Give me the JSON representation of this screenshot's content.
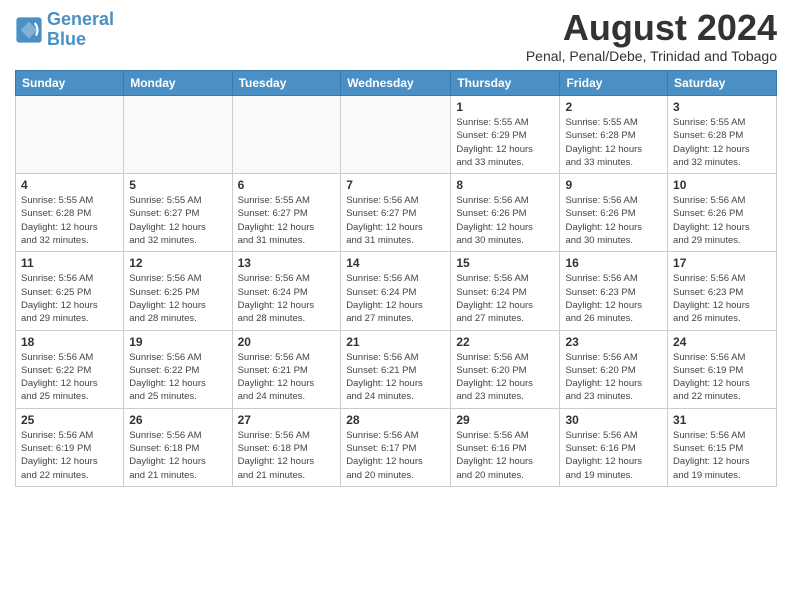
{
  "logo": {
    "text1": "General",
    "text2": "Blue"
  },
  "title": "August 2024",
  "location": "Penal, Penal/Debe, Trinidad and Tobago",
  "days_of_week": [
    "Sunday",
    "Monday",
    "Tuesday",
    "Wednesday",
    "Thursday",
    "Friday",
    "Saturday"
  ],
  "weeks": [
    [
      {
        "day": "",
        "info": ""
      },
      {
        "day": "",
        "info": ""
      },
      {
        "day": "",
        "info": ""
      },
      {
        "day": "",
        "info": ""
      },
      {
        "day": "1",
        "info": "Sunrise: 5:55 AM\nSunset: 6:29 PM\nDaylight: 12 hours\nand 33 minutes."
      },
      {
        "day": "2",
        "info": "Sunrise: 5:55 AM\nSunset: 6:28 PM\nDaylight: 12 hours\nand 33 minutes."
      },
      {
        "day": "3",
        "info": "Sunrise: 5:55 AM\nSunset: 6:28 PM\nDaylight: 12 hours\nand 32 minutes."
      }
    ],
    [
      {
        "day": "4",
        "info": "Sunrise: 5:55 AM\nSunset: 6:28 PM\nDaylight: 12 hours\nand 32 minutes."
      },
      {
        "day": "5",
        "info": "Sunrise: 5:55 AM\nSunset: 6:27 PM\nDaylight: 12 hours\nand 32 minutes."
      },
      {
        "day": "6",
        "info": "Sunrise: 5:55 AM\nSunset: 6:27 PM\nDaylight: 12 hours\nand 31 minutes."
      },
      {
        "day": "7",
        "info": "Sunrise: 5:56 AM\nSunset: 6:27 PM\nDaylight: 12 hours\nand 31 minutes."
      },
      {
        "day": "8",
        "info": "Sunrise: 5:56 AM\nSunset: 6:26 PM\nDaylight: 12 hours\nand 30 minutes."
      },
      {
        "day": "9",
        "info": "Sunrise: 5:56 AM\nSunset: 6:26 PM\nDaylight: 12 hours\nand 30 minutes."
      },
      {
        "day": "10",
        "info": "Sunrise: 5:56 AM\nSunset: 6:26 PM\nDaylight: 12 hours\nand 29 minutes."
      }
    ],
    [
      {
        "day": "11",
        "info": "Sunrise: 5:56 AM\nSunset: 6:25 PM\nDaylight: 12 hours\nand 29 minutes."
      },
      {
        "day": "12",
        "info": "Sunrise: 5:56 AM\nSunset: 6:25 PM\nDaylight: 12 hours\nand 28 minutes."
      },
      {
        "day": "13",
        "info": "Sunrise: 5:56 AM\nSunset: 6:24 PM\nDaylight: 12 hours\nand 28 minutes."
      },
      {
        "day": "14",
        "info": "Sunrise: 5:56 AM\nSunset: 6:24 PM\nDaylight: 12 hours\nand 27 minutes."
      },
      {
        "day": "15",
        "info": "Sunrise: 5:56 AM\nSunset: 6:24 PM\nDaylight: 12 hours\nand 27 minutes."
      },
      {
        "day": "16",
        "info": "Sunrise: 5:56 AM\nSunset: 6:23 PM\nDaylight: 12 hours\nand 26 minutes."
      },
      {
        "day": "17",
        "info": "Sunrise: 5:56 AM\nSunset: 6:23 PM\nDaylight: 12 hours\nand 26 minutes."
      }
    ],
    [
      {
        "day": "18",
        "info": "Sunrise: 5:56 AM\nSunset: 6:22 PM\nDaylight: 12 hours\nand 25 minutes."
      },
      {
        "day": "19",
        "info": "Sunrise: 5:56 AM\nSunset: 6:22 PM\nDaylight: 12 hours\nand 25 minutes."
      },
      {
        "day": "20",
        "info": "Sunrise: 5:56 AM\nSunset: 6:21 PM\nDaylight: 12 hours\nand 24 minutes."
      },
      {
        "day": "21",
        "info": "Sunrise: 5:56 AM\nSunset: 6:21 PM\nDaylight: 12 hours\nand 24 minutes."
      },
      {
        "day": "22",
        "info": "Sunrise: 5:56 AM\nSunset: 6:20 PM\nDaylight: 12 hours\nand 23 minutes."
      },
      {
        "day": "23",
        "info": "Sunrise: 5:56 AM\nSunset: 6:20 PM\nDaylight: 12 hours\nand 23 minutes."
      },
      {
        "day": "24",
        "info": "Sunrise: 5:56 AM\nSunset: 6:19 PM\nDaylight: 12 hours\nand 22 minutes."
      }
    ],
    [
      {
        "day": "25",
        "info": "Sunrise: 5:56 AM\nSunset: 6:19 PM\nDaylight: 12 hours\nand 22 minutes."
      },
      {
        "day": "26",
        "info": "Sunrise: 5:56 AM\nSunset: 6:18 PM\nDaylight: 12 hours\nand 21 minutes."
      },
      {
        "day": "27",
        "info": "Sunrise: 5:56 AM\nSunset: 6:18 PM\nDaylight: 12 hours\nand 21 minutes."
      },
      {
        "day": "28",
        "info": "Sunrise: 5:56 AM\nSunset: 6:17 PM\nDaylight: 12 hours\nand 20 minutes."
      },
      {
        "day": "29",
        "info": "Sunrise: 5:56 AM\nSunset: 6:16 PM\nDaylight: 12 hours\nand 20 minutes."
      },
      {
        "day": "30",
        "info": "Sunrise: 5:56 AM\nSunset: 6:16 PM\nDaylight: 12 hours\nand 19 minutes."
      },
      {
        "day": "31",
        "info": "Sunrise: 5:56 AM\nSunset: 6:15 PM\nDaylight: 12 hours\nand 19 minutes."
      }
    ]
  ]
}
